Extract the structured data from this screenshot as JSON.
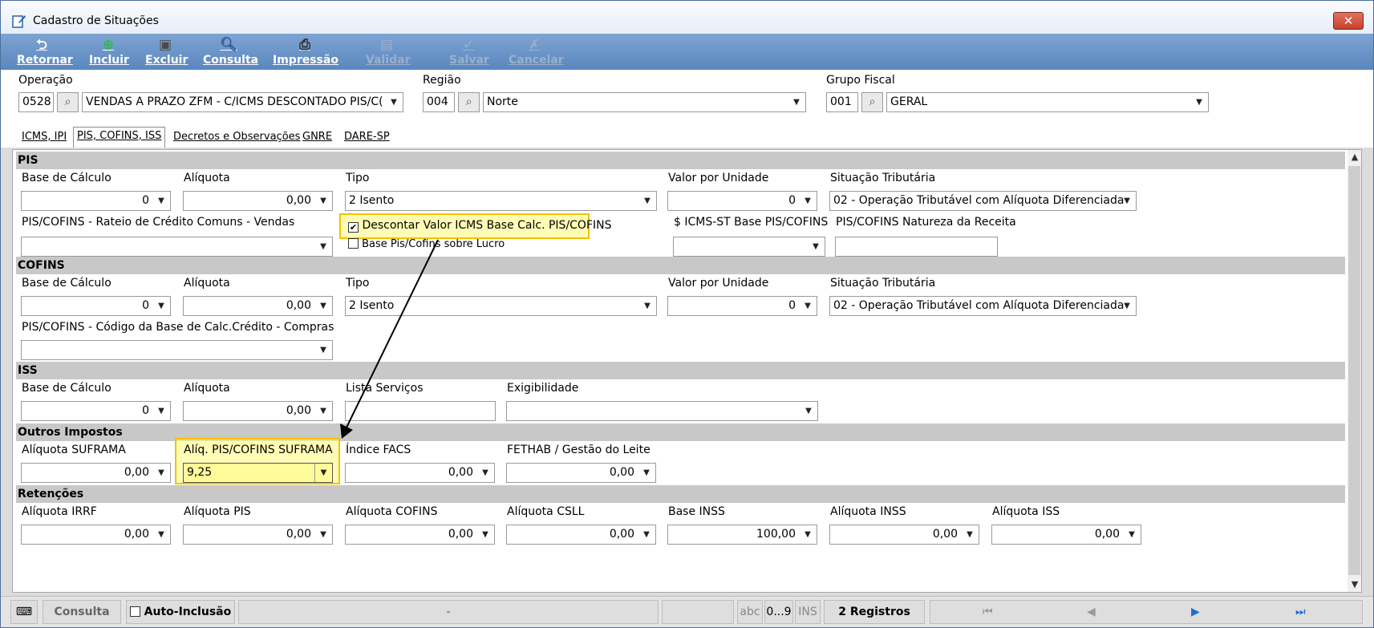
{
  "window": {
    "title": "Cadastro de Situações",
    "close": "✕"
  },
  "toolbar": {
    "retornar": "Retornar",
    "incluir": "Incluir",
    "excluir": "Excluir",
    "consulta": "Consulta",
    "impressao": "Impressão",
    "validar": "Validar",
    "salvar": "Salvar",
    "cancelar": "Cancelar"
  },
  "header": {
    "operacao_label": "Operação",
    "operacao_code": "0528",
    "operacao_value": "VENDAS A PRAZO ZFM - C/ICMS DESCONTADO PIS/C(",
    "regiao_label": "Região",
    "regiao_code": "004",
    "regiao_value": "Norte",
    "grupo_label": "Grupo Fiscal",
    "grupo_code": "001",
    "grupo_value": "GERAL"
  },
  "tabs": [
    "ICMS, IPI",
    "PIS, COFINS, ISS",
    "Decretos e Observações",
    "GNRE",
    "DARE-SP"
  ],
  "pis": {
    "title": "PIS",
    "base_label": "Base de Cálculo",
    "base_value": "0",
    "aliquota_label": "Alíquota",
    "aliquota_value": "0,00",
    "tipo_label": "Tipo",
    "tipo_value": "2 Isento",
    "valor_unidade_label": "Valor por Unidade",
    "valor_unidade_value": "0",
    "situacao_label": "Situação Tributária",
    "situacao_value": "02 - Operação Tributável com Alíquota Diferenciada",
    "rateio_label": "PIS/COFINS - Rateio de Crédito Comuns - Vendas",
    "descontar_label": "Descontar Valor ICMS Base Calc. PIS/COFINS",
    "descontar_checked": "✔",
    "base_lucro_label": "Base Pis/Cofins sobre Lucro",
    "icms_st_label": "$ ICMS-ST Base PIS/COFINS",
    "natureza_label": "PIS/COFINS Natureza da Receita"
  },
  "cofins": {
    "title": "COFINS",
    "base_label": "Base de Cálculo",
    "base_value": "0",
    "aliquota_label": "Alíquota",
    "aliquota_value": "0,00",
    "tipo_label": "Tipo",
    "tipo_value": "2 Isento",
    "valor_unidade_label": "Valor por Unidade",
    "valor_unidade_value": "0",
    "situacao_label": "Situação Tributária",
    "situacao_value": "02 - Operação Tributável com Alíquota Diferenciada",
    "codigo_label": "PIS/COFINS - Código da Base de Calc.Crédito - Compras"
  },
  "iss": {
    "title": "ISS",
    "base_label": "Base de Cálculo",
    "base_value": "0",
    "aliquota_label": "Alíquota",
    "aliquota_value": "0,00",
    "lista_label": "Lista Serviços",
    "exigibilidade_label": "Exigibilidade"
  },
  "outros": {
    "title": "Outros Impostos",
    "suframa_label": "Alíquota SUFRAMA",
    "suframa_value": "0,00",
    "pis_cofins_suframa_label": "Alíq. PIS/COFINS SUFRAMA",
    "pis_cofins_suframa_value": "9,25",
    "facs_label": "Índice FACS",
    "facs_value": "0,00",
    "fethab_label": "FETHAB / Gestão do Leite",
    "fethab_value": "0,00"
  },
  "retencoes": {
    "title": "Retenções",
    "irrf_label": "Alíquota IRRF",
    "irrf_value": "0,00",
    "pis_label": "Alíquota PIS",
    "pis_value": "0,00",
    "cofins_label": "Alíquota COFINS",
    "cofins_value": "0,00",
    "csll_label": "Alíquota CSLL",
    "csll_value": "0,00",
    "inss_base_label": "Base INSS",
    "inss_base_value": "100,00",
    "inss_label": "Alíquota INSS",
    "inss_value": "0,00",
    "iss_label": "Alíquota ISS",
    "iss_value": "0,00"
  },
  "status": {
    "consulta": "Consulta",
    "auto_inclusao": "Auto-Inclusão",
    "dash": "-",
    "abc": "abc",
    "num": "0...9",
    "ins": "INS",
    "registros": "2 Registros"
  },
  "colors": {
    "toolbar": "#6b95c9",
    "highlight": "#f2c200",
    "section": "#c8c8c8"
  }
}
